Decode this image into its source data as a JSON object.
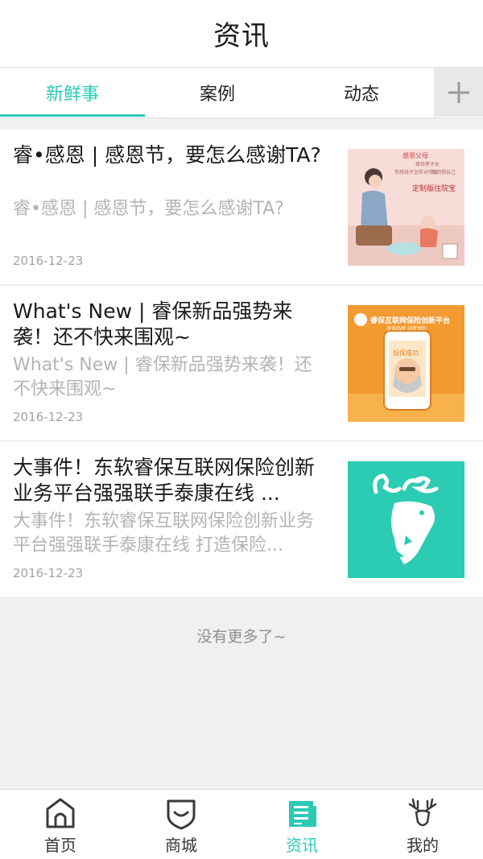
{
  "header": {
    "title": "资讯"
  },
  "tabs": [
    {
      "label": "新鲜事",
      "active": true
    },
    {
      "label": "案例",
      "active": false
    },
    {
      "label": "动态",
      "active": false
    }
  ],
  "tab_add_icon": "plus-icon",
  "news": [
    {
      "title": "睿•感恩 | 感恩节，要怎么感谢TA?",
      "desc": "睿•感恩 | 感恩节，要怎么感谢TA?",
      "date": "2016-12-23",
      "thumb": {
        "lines": [
          "感恩父母",
          "体验孝子女",
          "你想孩子怎样对待你",
          "先回想自己",
          "定制版往院宝"
        ]
      }
    },
    {
      "title": "What's New | 睿保新品强势来袭！还不快来围观~",
      "desc": "What's New | 睿保新品强势来袭！还不快来围观~",
      "date": "2016-12-23",
      "thumb": {
        "lines": [
          "睿保互联网保险创新平台",
          "睿保品牌 创新保险",
          "投保成功"
        ]
      }
    },
    {
      "title": "大事件！东软睿保互联网保险创新业务平台强强联手泰康在线 ...",
      "desc": "大事件！东软睿保互联网保险创新业务平台强强联手泰康在线 打造保险...",
      "date": "2016-12-23",
      "thumb": {
        "lines": []
      }
    }
  ],
  "footer": {
    "no_more": "没有更多了~"
  },
  "bottom_nav": [
    {
      "label": "首页",
      "icon": "home-icon",
      "active": false
    },
    {
      "label": "商城",
      "icon": "shield-icon",
      "active": false
    },
    {
      "label": "资讯",
      "icon": "news-icon",
      "active": true
    },
    {
      "label": "我的",
      "icon": "deer-icon",
      "active": false
    }
  ],
  "colors": {
    "accent": "#2cc9b5",
    "thumb3_bg": "#2ccbb4",
    "thumb2_bg": "#f29a2f",
    "thumb1_bg": "#f6d6d4"
  }
}
